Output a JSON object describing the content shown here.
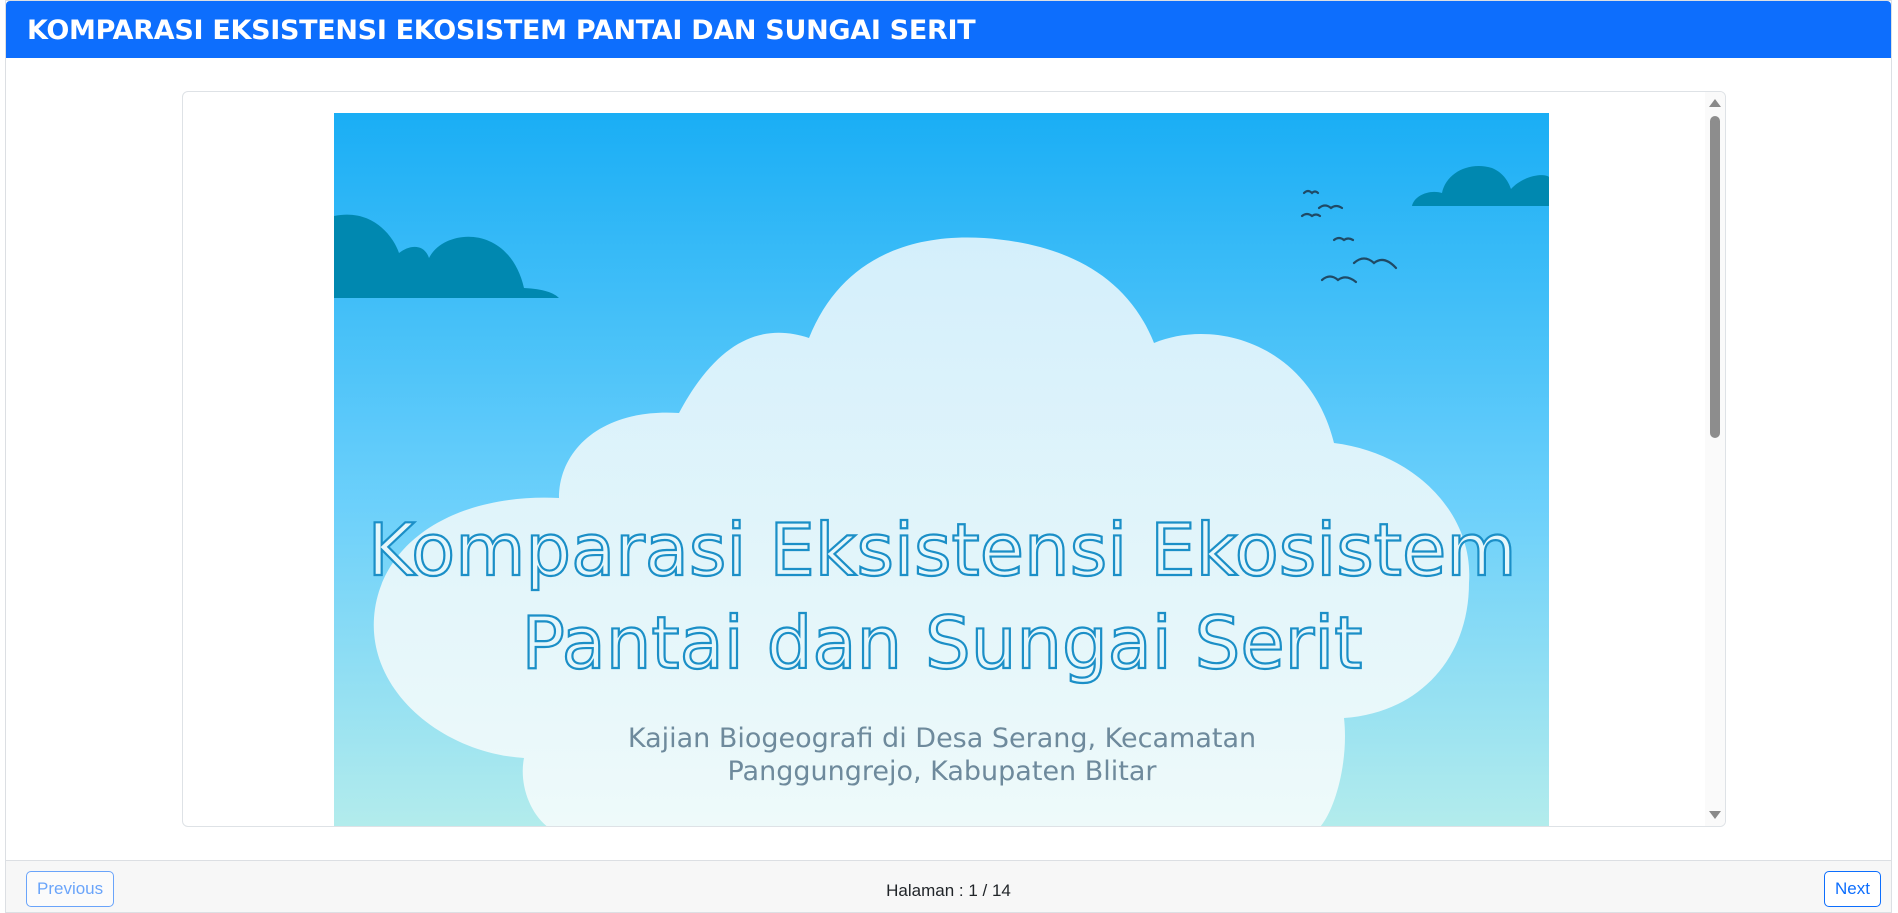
{
  "header": {
    "title": "KOMPARASI EKSISTENSI EKOSISTEM PANTAI DAN SUNGAI SERIT"
  },
  "slide": {
    "title_line1": "Komparasi Eksistensi Ekosistem",
    "title_line2": "Pantai dan Sungai Serit",
    "subtitle_line1": "Kajian Biogeografi di Desa Serang, Kecamatan",
    "subtitle_line2": "Panggungrejo, Kabupaten Blitar"
  },
  "footer": {
    "previous_label": "Previous",
    "next_label": "Next",
    "page_prefix": "Halaman : ",
    "page_current": "1",
    "page_total": "14",
    "page_display": "Halaman : 1 / 14"
  },
  "colors": {
    "header_bg": "#0d6efd",
    "sky_top": "#1aaef5",
    "sky_bottom": "#b3ecec",
    "cloud_dark": "#0088b0",
    "title_color": "#1b8fc7"
  }
}
